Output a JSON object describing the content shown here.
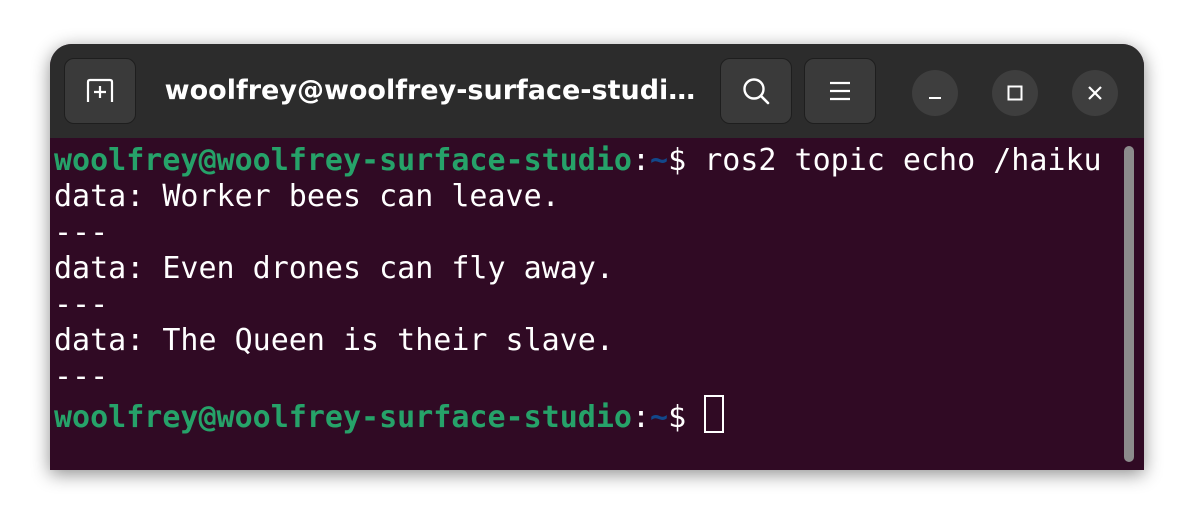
{
  "window": {
    "title": "woolfrey@woolfrey-surface-studi…"
  },
  "titlebar": {
    "icons": {
      "new_tab": "new-tab-icon",
      "search": "search-icon",
      "menu": "hamburger-menu-icon",
      "minimize": "minimize-icon",
      "maximize": "maximize-icon",
      "close": "close-icon"
    }
  },
  "terminal": {
    "colors": {
      "background": "#300a24",
      "prompt_user": "#26a269",
      "prompt_path": "#12488b",
      "text": "#ffffff"
    },
    "prompt": {
      "user_host": "woolfrey@woolfrey-surface-studio",
      "colon": ":",
      "path": "~",
      "symbol": "$ "
    },
    "command": "ros2 topic echo /haiku",
    "output": [
      "data: Worker bees can leave.",
      "---",
      "data: Even drones can fly away.",
      "---",
      "data: The Queen is their slave.",
      "---"
    ]
  }
}
